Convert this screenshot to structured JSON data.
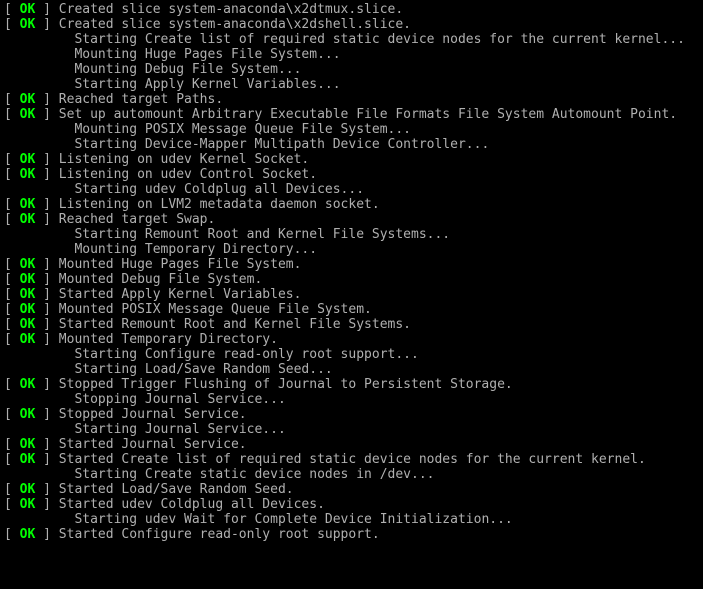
{
  "status_ok": "OK",
  "bracket_open": "[  ",
  "bracket_close": "  ] ",
  "indent": "         ",
  "lines": [
    {
      "status": true,
      "text": "Created slice system-anaconda\\x2dtmux.slice."
    },
    {
      "status": true,
      "text": "Created slice system-anaconda\\x2dshell.slice."
    },
    {
      "status": false,
      "text": "Starting Create list of required static device nodes for the current kernel..."
    },
    {
      "status": false,
      "text": "Mounting Huge Pages File System..."
    },
    {
      "status": false,
      "text": "Mounting Debug File System..."
    },
    {
      "status": false,
      "text": "Starting Apply Kernel Variables..."
    },
    {
      "status": true,
      "text": "Reached target Paths."
    },
    {
      "status": true,
      "text": "Set up automount Arbitrary Executable File Formats File System Automount Point."
    },
    {
      "status": false,
      "text": "Mounting POSIX Message Queue File System..."
    },
    {
      "status": false,
      "text": "Starting Device-Mapper Multipath Device Controller..."
    },
    {
      "status": true,
      "text": "Listening on udev Kernel Socket."
    },
    {
      "status": true,
      "text": "Listening on udev Control Socket."
    },
    {
      "status": false,
      "text": "Starting udev Coldplug all Devices..."
    },
    {
      "status": true,
      "text": "Listening on LVM2 metadata daemon socket."
    },
    {
      "status": true,
      "text": "Reached target Swap."
    },
    {
      "status": false,
      "text": "Starting Remount Root and Kernel File Systems..."
    },
    {
      "status": false,
      "text": "Mounting Temporary Directory..."
    },
    {
      "status": true,
      "text": "Mounted Huge Pages File System."
    },
    {
      "status": true,
      "text": "Mounted Debug File System."
    },
    {
      "status": true,
      "text": "Started Apply Kernel Variables."
    },
    {
      "status": true,
      "text": "Mounted POSIX Message Queue File System."
    },
    {
      "status": true,
      "text": "Started Remount Root and Kernel File Systems."
    },
    {
      "status": true,
      "text": "Mounted Temporary Directory."
    },
    {
      "status": false,
      "text": "Starting Configure read-only root support..."
    },
    {
      "status": false,
      "text": "Starting Load/Save Random Seed..."
    },
    {
      "status": true,
      "text": "Stopped Trigger Flushing of Journal to Persistent Storage."
    },
    {
      "status": false,
      "text": "Stopping Journal Service..."
    },
    {
      "status": true,
      "text": "Stopped Journal Service."
    },
    {
      "status": false,
      "text": "Starting Journal Service..."
    },
    {
      "status": true,
      "text": "Started Journal Service."
    },
    {
      "status": true,
      "text": "Started Create list of required static device nodes for the current kernel."
    },
    {
      "status": false,
      "text": "Starting Create static device nodes in /dev..."
    },
    {
      "status": true,
      "text": "Started Load/Save Random Seed."
    },
    {
      "status": true,
      "text": "Started udev Coldplug all Devices."
    },
    {
      "status": false,
      "text": "Starting udev Wait for Complete Device Initialization..."
    },
    {
      "status": true,
      "text": "Started Configure read-only root support."
    }
  ]
}
